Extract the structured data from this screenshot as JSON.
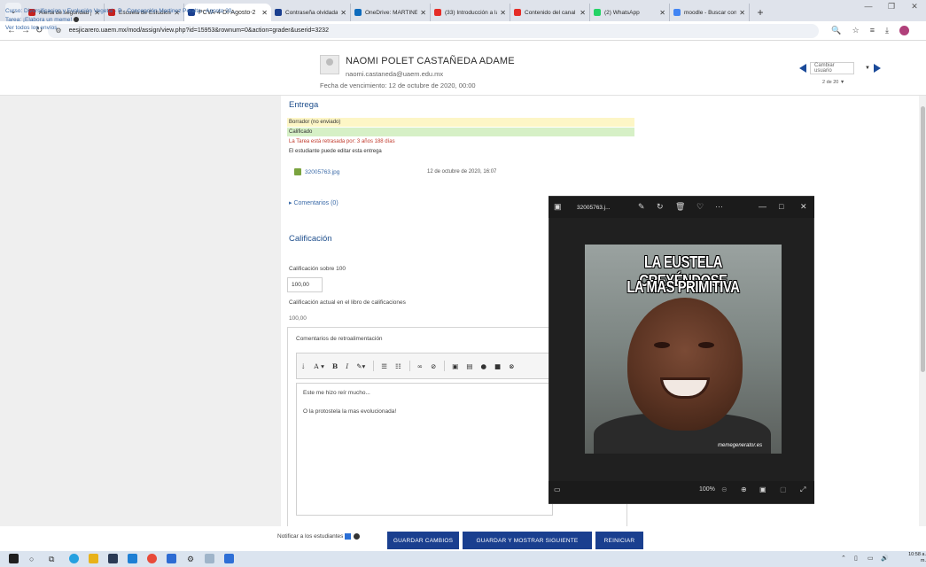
{
  "browser": {
    "tabs": [
      {
        "title": "Alerta de seguridad j",
        "favicon": "gmail-icon",
        "color": "#c5221f",
        "active": false
      },
      {
        "title": "Escuela de Estudios S",
        "favicon": "gmail-icon",
        "color": "#c5221f",
        "active": false
      },
      {
        "title": "PCVA-4-DI-Agosto-2",
        "favicon": "moodle-icon",
        "color": "#1a3f8f",
        "active": true
      },
      {
        "title": "Contraseña olvidada",
        "favicon": "moodle-icon",
        "color": "#1a3f8f",
        "active": false
      },
      {
        "title": "OneDrive: MARTINEZ",
        "favicon": "onedrive-icon",
        "color": "#0f6cbd",
        "active": false
      },
      {
        "title": "(33) Introducción a la",
        "favicon": "youtube-icon",
        "color": "#e52d27",
        "active": false
      },
      {
        "title": "Contenido del canal",
        "favicon": "youtube-icon",
        "color": "#e52d27",
        "active": false
      },
      {
        "title": "(2) WhatsApp",
        "favicon": "whatsapp-icon",
        "color": "#25d366",
        "active": false
      },
      {
        "title": "moodle - Buscar con",
        "favicon": "google-icon",
        "color": "#4285f4",
        "active": false
      }
    ],
    "url": "eesjicarero.uaem.mx/mod/assign/view.php?id=15953&rownum=0&action=grader&userid=3232"
  },
  "header": {
    "course": "Curso: Diversificacion y Evolución Vegetal - B - Concepción Martinez Peralta - Agosto 20...",
    "assignment": "Tarea: ¡Elabora un meme!",
    "view_all": "Ver todos los envíos",
    "student_name": "NAOMI POLET CASTAÑEDA ADAME",
    "student_email": "naomi.castaneda@uaem.edu.mx",
    "due_date": "Fecha de vencimiento: 12 de octubre de 2020, 00:00",
    "change_user": "Cambiar usuario",
    "page_count": "2 de 20"
  },
  "submission": {
    "title": "Entrega",
    "status_draft": "Borrador (no enviado)",
    "status_graded": "Calificado",
    "late_notice": "La Tarea está retrasada por: 3 años 188 días",
    "can_edit": "El estudiante puede editar esta entrega",
    "file_name": "32005763.jpg",
    "file_date": "12 de octubre de 2020, 16:07",
    "comments": "Comentarios (0)"
  },
  "grade": {
    "title": "Calificación",
    "out_of_label": "Calificación sobre 100",
    "value": "100,00",
    "gradebook_label": "Calificación actual en el libro de calificaciones",
    "gradebook_value": "100,00"
  },
  "feedback": {
    "label": "Comentarios de retroalimentación",
    "line1": "Este me hizo reír mucho...",
    "line2": "O la protostela la mas evolucionada!"
  },
  "footer": {
    "notify": "Notificar a los estudiantes",
    "save": "GUARDAR CAMBIOS",
    "save_next": "GUARDAR Y MOSTRAR SIGUIENTE",
    "reset": "REINICIAR"
  },
  "viewer": {
    "file_name": "32005763.j...",
    "meme_line1": "LA EUSTELA CREYÉNDOSE",
    "meme_line2": "LA MAS PRIMITIVA",
    "watermark": "memegenerator.es",
    "zoom": "100%"
  },
  "taskbar": {
    "time": "10:58 a. m."
  }
}
